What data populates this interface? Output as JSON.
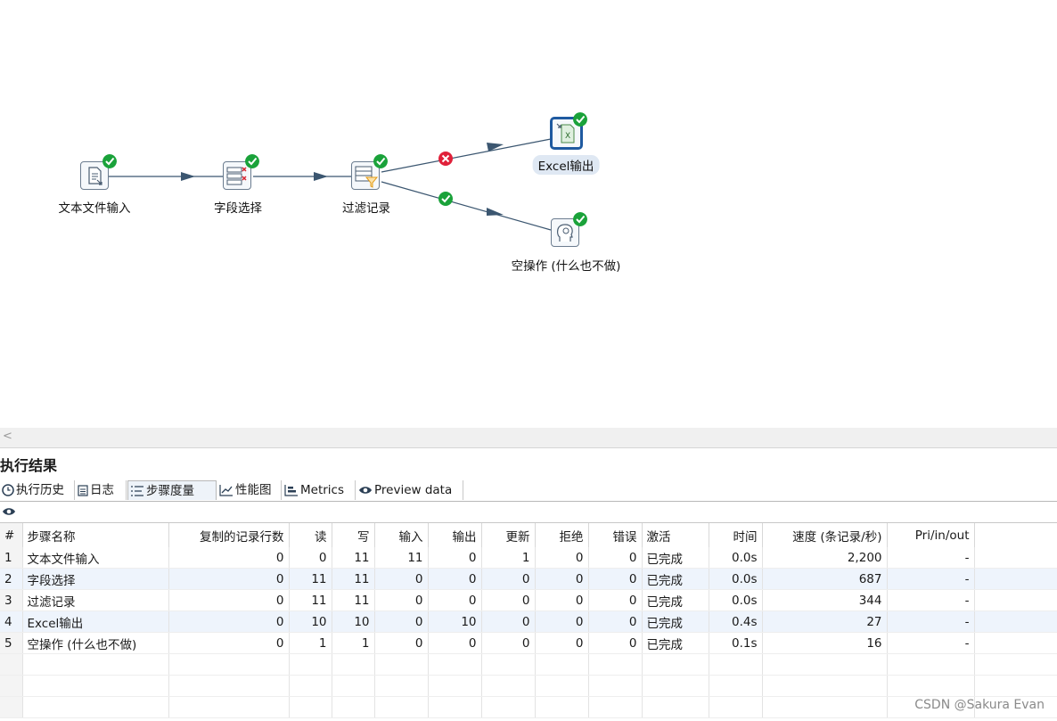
{
  "canvas": {
    "nodes": [
      {
        "id": "text-input",
        "label": "文本文件输入",
        "status": "ok"
      },
      {
        "id": "select-values",
        "label": "字段选择",
        "status": "ok"
      },
      {
        "id": "filter-rows",
        "label": "过滤记录",
        "status": "ok"
      },
      {
        "id": "excel-output",
        "label": "Excel输出",
        "status": "ok",
        "selected": true
      },
      {
        "id": "dummy",
        "label": "空操作 (什么也不做)",
        "status": "ok"
      }
    ],
    "hops": [
      {
        "from": "文本文件输入",
        "to": "字段选择"
      },
      {
        "from": "字段选择",
        "to": "过滤记录"
      },
      {
        "from": "过滤记录",
        "to": "Excel输出",
        "condition": "false"
      },
      {
        "from": "过滤记录",
        "to": "空操作 (什么也不做)",
        "condition": "true"
      }
    ],
    "colors": {
      "hop": "#3b5670",
      "ok": "#1aa23a",
      "error": "#e0213a",
      "selected": "#1f5aa0"
    }
  },
  "panel": {
    "title": "执行结果",
    "tabs": [
      "执行历史",
      "日志",
      "步骤度量",
      "性能图",
      "Metrics",
      "Preview data"
    ],
    "active_tab": "步骤度量",
    "toolbar_icon": "eye-icon"
  },
  "table": {
    "columns": [
      "#",
      "步骤名称",
      "复制的记录行数",
      "读",
      "写",
      "输入",
      "输出",
      "更新",
      "拒绝",
      "错误",
      "激活",
      "时间",
      "速度 (条记录/秒)",
      "Pri/in/out"
    ],
    "rows": [
      [
        "1",
        "文本文件输入",
        "0",
        "0",
        "11",
        "11",
        "0",
        "1",
        "0",
        "0",
        "已完成",
        "0.0s",
        "2,200",
        "-"
      ],
      [
        "2",
        "字段选择",
        "0",
        "11",
        "11",
        "0",
        "0",
        "0",
        "0",
        "0",
        "已完成",
        "0.0s",
        "687",
        "-"
      ],
      [
        "3",
        "过滤记录",
        "0",
        "11",
        "11",
        "0",
        "0",
        "0",
        "0",
        "0",
        "已完成",
        "0.0s",
        "344",
        "-"
      ],
      [
        "4",
        "Excel输出",
        "0",
        "10",
        "10",
        "0",
        "10",
        "0",
        "0",
        "0",
        "已完成",
        "0.4s",
        "27",
        "-"
      ],
      [
        "5",
        "空操作 (什么也不做)",
        "0",
        "1",
        "1",
        "0",
        "0",
        "0",
        "0",
        "0",
        "已完成",
        "0.1s",
        "16",
        "-"
      ]
    ]
  },
  "watermark": "CSDN @Sakura Evan"
}
